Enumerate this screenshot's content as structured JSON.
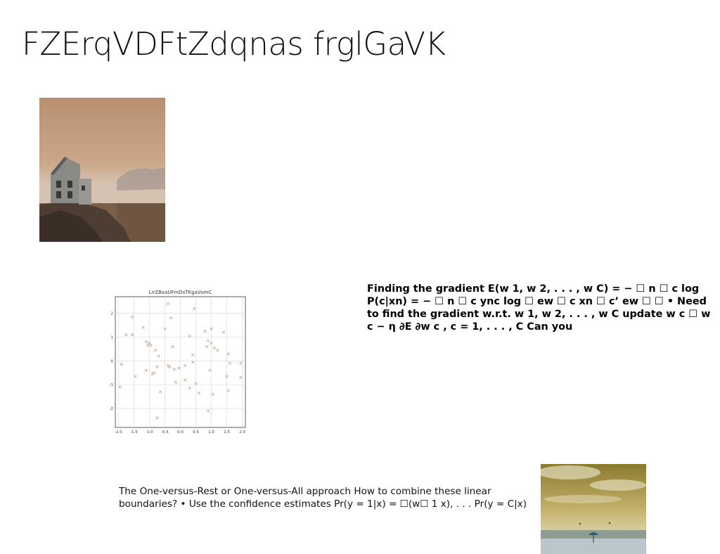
{
  "slide": {
    "title": "FZErqVDFtZdqnas frglGaVK",
    "text_gradient": "Finding the gradient E(w 1, w 2, . . . , w C) = − ☐ n ☐ c log P(c|xn) = − ☐ n ☐ c ync log ☐ ew ☐ c xn ☐ c’ ew ☐ ☐ • Need to find the gradient w.r.t. w 1, w 2, . . . , w C update w c ☐ w c − η ∂E ∂w c , c = 1, . . . , C Can you",
    "text_ovr": "The One-versus-Rest or One-versus-All approach How to combine these linear boundaries? • Use the confidence estimates Pr(y = 1|x) = ☐(w☐ 1 x), . . . Pr(y = C|x)"
  },
  "chart_data": {
    "type": "scatter",
    "title": "LirZBxaUFmDsTKgaVumC",
    "xlim": [
      -2.1,
      2.1
    ],
    "ylim": [
      -2.8,
      2.7
    ],
    "x_ticks": [
      -2.0,
      -1.5,
      -1.0,
      -0.5,
      0.0,
      0.5,
      1.0,
      1.5,
      2.0
    ],
    "x_tick_labels": [
      "-2.0",
      "-1.5",
      "-1.0",
      "-0.5",
      "0.0",
      "0.5",
      "1.0",
      "1.5",
      "2.0"
    ],
    "y_ticks": [
      2,
      1,
      0,
      -1,
      -2
    ],
    "y_tick_labels": [
      "2",
      "1",
      "0",
      "-1",
      "-2"
    ],
    "grid": true,
    "marker": "x",
    "marker_color": "#c7a28a",
    "points": [
      [
        -1.9,
        -0.15
      ],
      [
        -1.95,
        -1.1
      ],
      [
        -1.75,
        1.1
      ],
      [
        -1.55,
        1.85
      ],
      [
        -1.55,
        1.1
      ],
      [
        -1.45,
        -0.65
      ],
      [
        -1.2,
        1.4
      ],
      [
        -1.1,
        0.8
      ],
      [
        -1.05,
        0.65
      ],
      [
        -1.0,
        0.75
      ],
      [
        -1.1,
        -0.4
      ],
      [
        -0.95,
        0.65
      ],
      [
        -0.9,
        -0.55
      ],
      [
        -0.85,
        -0.5
      ],
      [
        -0.8,
        0.45
      ],
      [
        -0.75,
        -0.25
      ],
      [
        -0.7,
        0.2
      ],
      [
        -0.65,
        -1.3
      ],
      [
        -0.75,
        -2.4
      ],
      [
        -0.5,
        1.35
      ],
      [
        -0.4,
        2.4
      ],
      [
        -0.4,
        -0.2
      ],
      [
        -0.35,
        -0.25
      ],
      [
        -0.3,
        1.8
      ],
      [
        -0.25,
        0.6
      ],
      [
        -0.2,
        -0.35
      ],
      [
        -0.15,
        -0.9
      ],
      [
        -0.05,
        -0.3
      ],
      [
        0.15,
        -0.2
      ],
      [
        0.15,
        -0.8
      ],
      [
        0.3,
        1.05
      ],
      [
        0.3,
        -1.15
      ],
      [
        0.4,
        0.25
      ],
      [
        0.4,
        -0.05
      ],
      [
        0.45,
        2.2
      ],
      [
        0.5,
        -0.95
      ],
      [
        0.6,
        -1.35
      ],
      [
        0.8,
        1.25
      ],
      [
        0.85,
        0.6
      ],
      [
        0.9,
        0.85
      ],
      [
        0.9,
        -2.1
      ],
      [
        0.95,
        -0.4
      ],
      [
        1.0,
        1.35
      ],
      [
        1.0,
        0.75
      ],
      [
        1.05,
        -1.4
      ],
      [
        1.1,
        0.55
      ],
      [
        1.2,
        0.45
      ],
      [
        1.4,
        1.2
      ],
      [
        1.5,
        -0.65
      ],
      [
        1.55,
        0.3
      ],
      [
        1.6,
        -0.1
      ],
      [
        1.55,
        -1.25
      ],
      [
        1.95,
        -0.1
      ],
      [
        1.95,
        -0.7
      ]
    ]
  },
  "images": {
    "img1": "house on cliff photo",
    "img2": "beach with umbrella photo"
  }
}
